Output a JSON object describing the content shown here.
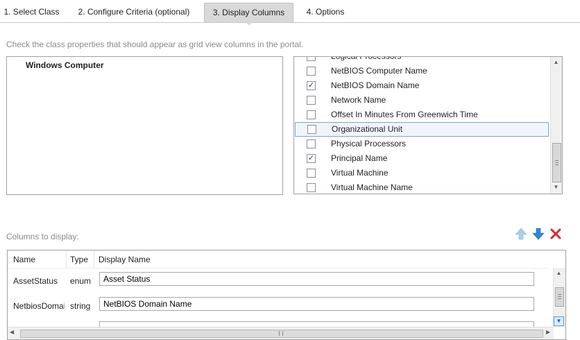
{
  "tabs": [
    {
      "label": "1. Select Class"
    },
    {
      "label": "2. Configure Criteria (optional)"
    },
    {
      "label": "3. Display Columns"
    },
    {
      "label": "4. Options"
    }
  ],
  "active_tab": "3. Display Columns",
  "instruction": "Check the class properties that should appear as grid view columns in the portal.",
  "class_tree": {
    "root": "Windows Computer"
  },
  "properties": [
    {
      "label": "Logical Processors",
      "checked": false,
      "selected": false
    },
    {
      "label": "NetBIOS Computer Name",
      "checked": false,
      "selected": false
    },
    {
      "label": "NetBIOS Domain Name",
      "checked": true,
      "selected": false
    },
    {
      "label": "Network Name",
      "checked": false,
      "selected": false
    },
    {
      "label": "Offset In Minutes From Greenwich Time",
      "checked": false,
      "selected": false
    },
    {
      "label": "Organizational Unit",
      "checked": false,
      "selected": true
    },
    {
      "label": "Physical Processors",
      "checked": false,
      "selected": false
    },
    {
      "label": "Principal Name",
      "checked": true,
      "selected": false
    },
    {
      "label": "Virtual Machine",
      "checked": false,
      "selected": false
    },
    {
      "label": "Virtual Machine Name",
      "checked": false,
      "selected": false
    }
  ],
  "columns_section": {
    "title": "Columns to display:",
    "actions": [
      {
        "name": "move-up-icon",
        "color": "#a9cdea"
      },
      {
        "name": "move-down-icon",
        "color": "#2e86d6"
      },
      {
        "name": "remove-icon",
        "color": "#d9262c"
      }
    ],
    "headers": {
      "name": "Name",
      "type": "Type",
      "display_name": "Display Name"
    },
    "rows": [
      {
        "name": "AssetStatus",
        "type": "enum",
        "display_name": "Asset Status"
      },
      {
        "name": "NetbiosDomainName",
        "type": "string",
        "display_name": "NetBIOS Domain Name"
      },
      {
        "name": "",
        "type": "",
        "display_name": ""
      }
    ]
  },
  "colors": {
    "selection_border": "#7da2ce",
    "selection_bg": "#f1f5fb",
    "check_mark": "#1a3a6e",
    "active_tab_bg": "#d9d9d9"
  }
}
